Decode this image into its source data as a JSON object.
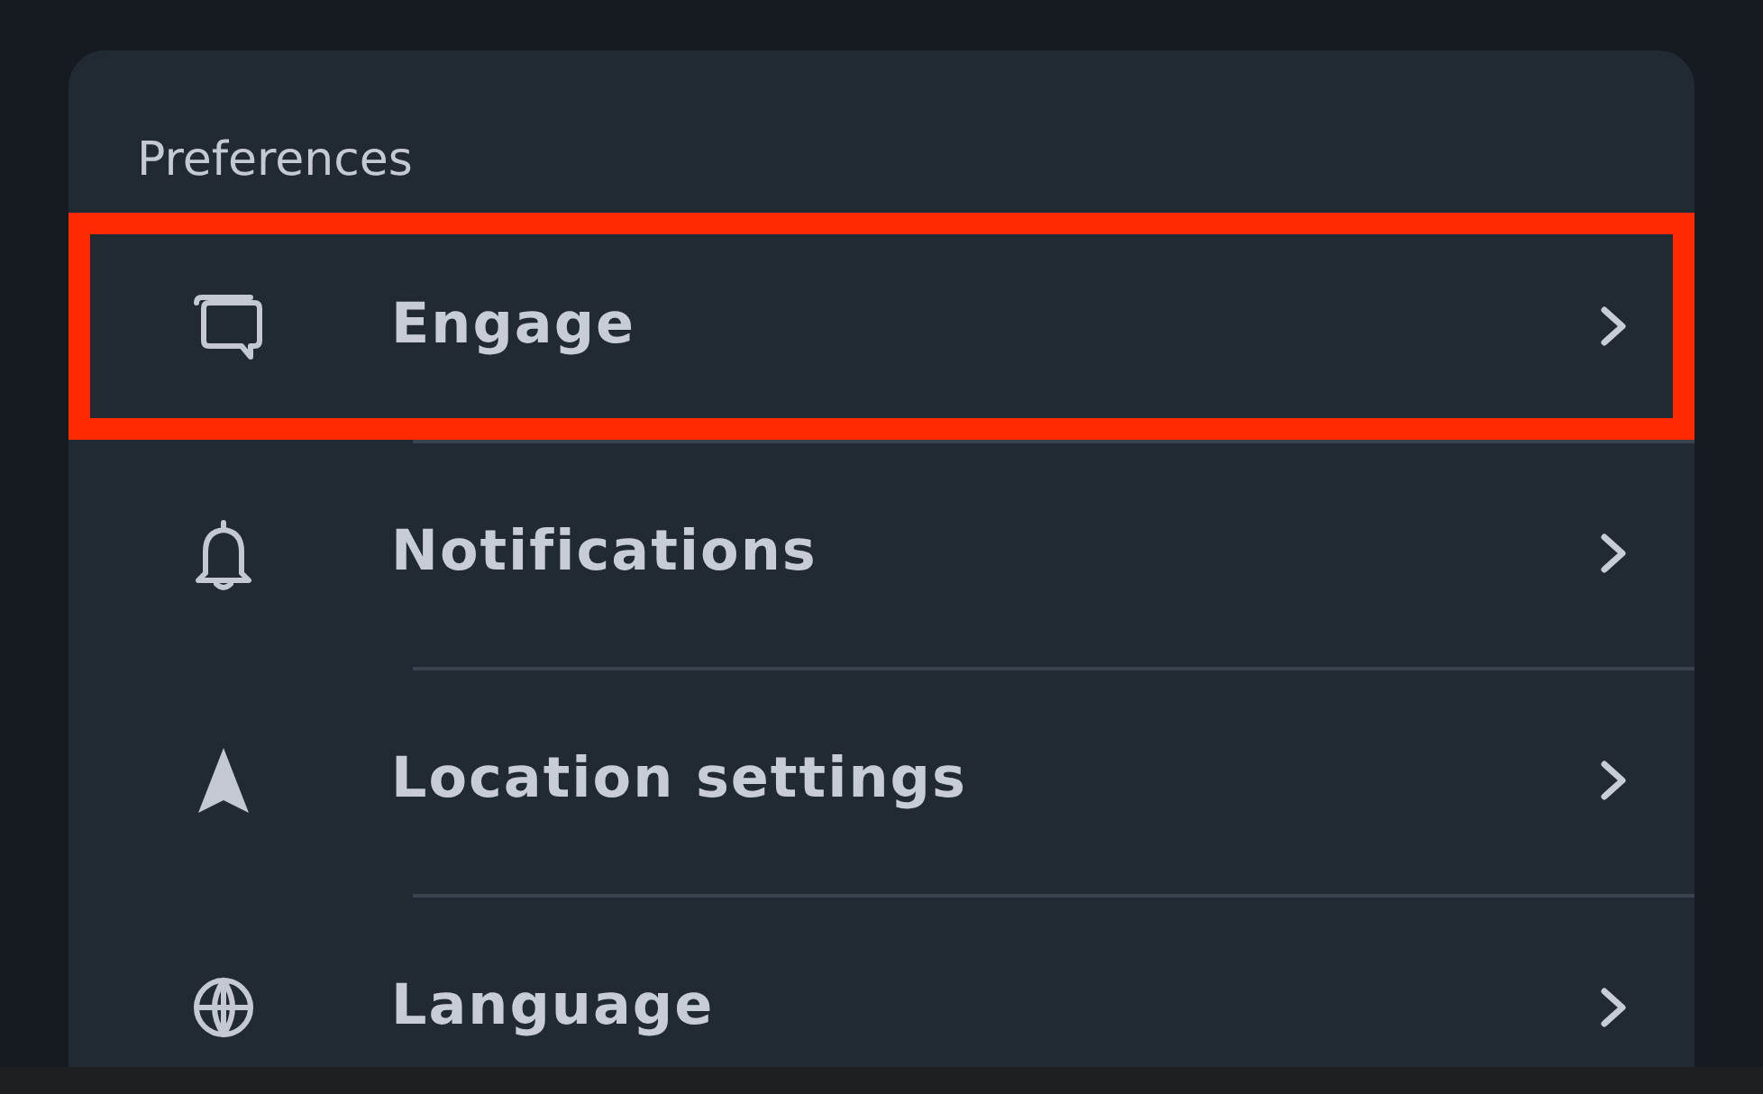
{
  "section": {
    "title": "Preferences"
  },
  "items": [
    {
      "label": "Engage",
      "highlighted": true
    },
    {
      "label": "Notifications",
      "highlighted": false
    },
    {
      "label": "Location settings",
      "highlighted": false
    },
    {
      "label": "Language",
      "highlighted": false
    }
  ]
}
